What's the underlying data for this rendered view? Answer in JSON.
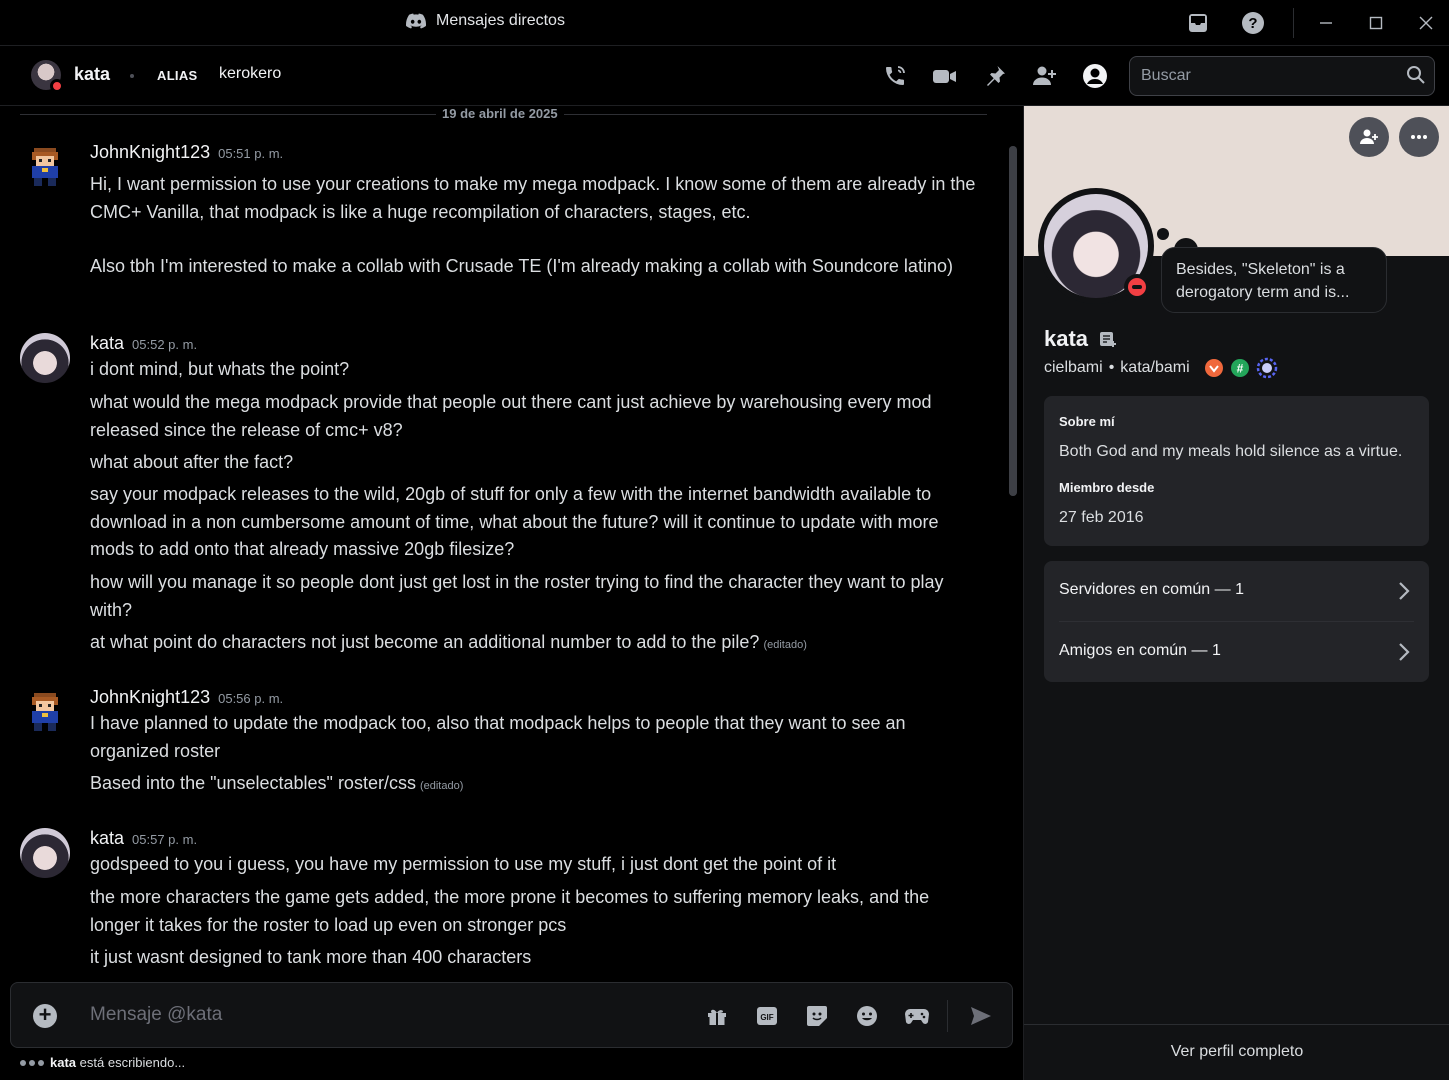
{
  "window": {
    "title": "Mensajes directos"
  },
  "header": {
    "name": "kata",
    "alias_label": "ALIAS",
    "alias": "kerokero",
    "search_placeholder": "Buscar"
  },
  "chat": {
    "date_divider": "19 de abril de 2025",
    "messages": [
      {
        "author": "JohnKnight123",
        "time": "05:51 p. m.",
        "lines": [
          "Hi, I want permission to use your creations to make my mega modpack. I know some of them are already in the CMC+ Vanilla, that modpack is like a huge recompilation of characters, stages, etc.",
          "Also tbh I'm interested to make a collab with Crusade TE (I'm already making a collab with Soundcore latino)"
        ]
      },
      {
        "author": "kata",
        "time": "05:52 p. m.",
        "lines": [
          "i dont mind, but whats the point?",
          "what would the mega modpack provide that people out there cant just achieve by warehousing every mod released since the release of cmc+ v8?",
          "what about after the fact?",
          "say your modpack releases to the wild, 20gb of stuff for only a few with the internet bandwidth available to download in a non cumbersome amount of time, what about the future? will it continue to update with more mods to add onto that already massive 20gb filesize?",
          "how will you manage it so people dont just get lost in the roster trying to find the character they want to play with?",
          "at what point do characters not just become an additional number to add to the pile?"
        ],
        "edited_label": "(editado)"
      },
      {
        "author": "JohnKnight123",
        "time": "05:56 p. m.",
        "lines": [
          "I have planned to update the modpack too, also that modpack helps to people that they want to see an organized roster",
          "Based into the \"unselectables\" roster/css"
        ],
        "edited_label": "(editado)"
      },
      {
        "author": "kata",
        "time": "05:57 p. m.",
        "lines": [
          "godspeed to you i guess, you have my permission to use my stuff, i just dont get the point of it",
          "the more characters the game gets added, the more prone it becomes to suffering memory leaks, and the longer it takes for the roster to load up even on stronger pcs",
          "it just wasnt designed to tank more than 400 characters"
        ]
      }
    ]
  },
  "composer": {
    "placeholder": "Mensaje @kata",
    "typing_user": "kata",
    "typing_text": "está escribiendo..."
  },
  "profile": {
    "status_bubble": "Besides, \"Skeleton\" is a derogatory term and is...",
    "display_name": "kata",
    "username": "cielbami",
    "pronouns": "kata/bami",
    "about_label": "Sobre mí",
    "about_text": "Both God and my meals hold silence as a virtue.",
    "member_since_label": "Miembro desde",
    "member_since": "27 feb 2016",
    "mutual_servers": "Servidores en común — 1",
    "mutual_friends": "Amigos en común — 1",
    "full_profile": "Ver perfil completo"
  },
  "colors": {
    "dnd": "#f23f43",
    "badge_orange": "#f0683c",
    "badge_teal": "#23a55a",
    "badge_blue": "#5865f2"
  }
}
